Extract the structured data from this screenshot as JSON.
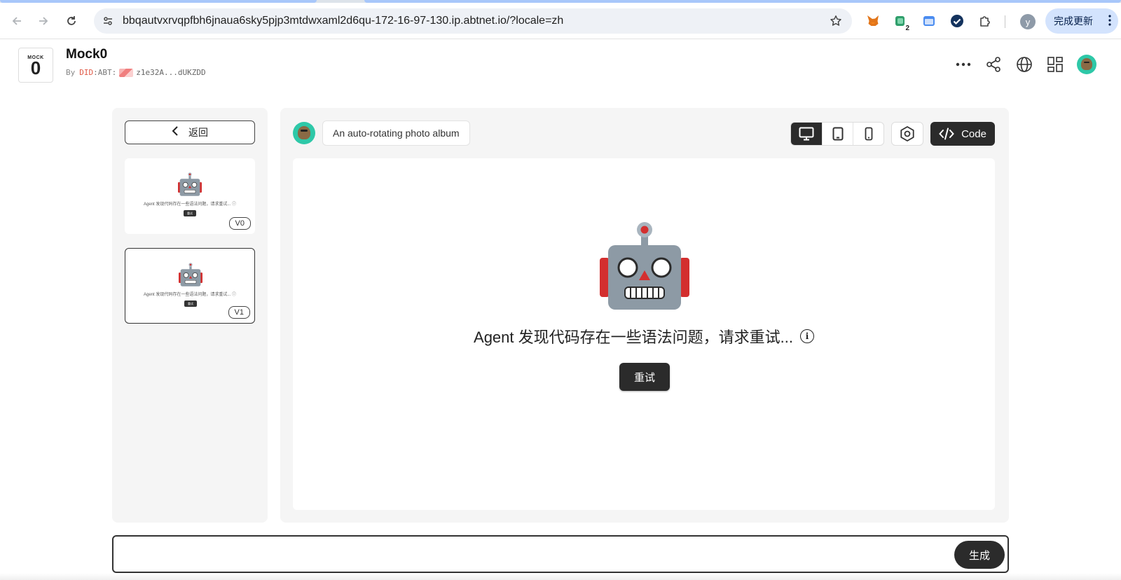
{
  "browser": {
    "url": "bbqautvxrvqpfbh6jnaua6sky5pjp3mtdwxaml2d6qu-172-16-97-130.ip.abtnet.io/?locale=zh",
    "extension_badge": "2",
    "profile_initial": "y",
    "update_label": "完成更新"
  },
  "app": {
    "logo_top": "MOCK",
    "logo_num": "0",
    "title": "Mock0",
    "by_label": "By",
    "did_label": "DID",
    "abt_label": ":ABT:",
    "address": "z1e32A...dUKZDD"
  },
  "sidebar": {
    "back_label": "返回",
    "versions": [
      {
        "tag": "V0",
        "preview_text": "Agent 发现代码存在一些语法问题，请求重试... ⓘ",
        "preview_btn": "重试",
        "active": false
      },
      {
        "tag": "V1",
        "preview_text": "Agent 发现代码存在一些语法问题，请求重试... ⓘ",
        "preview_btn": "重试",
        "active": true
      }
    ]
  },
  "main": {
    "prompt": "An auto-rotating photo album",
    "code_label": "Code",
    "error_message": "Agent 发现代码存在一些语法问题，请求重试...",
    "info_glyph": "i",
    "retry_label": "重试"
  },
  "composer": {
    "value": "",
    "placeholder": "",
    "generate_label": "生成"
  },
  "colors": {
    "dark_button": "#2b2b2b",
    "panel_bg": "#f5f5f5",
    "did_accent": "#e05a47",
    "chrome_update_pill": "#d3e3fd"
  }
}
